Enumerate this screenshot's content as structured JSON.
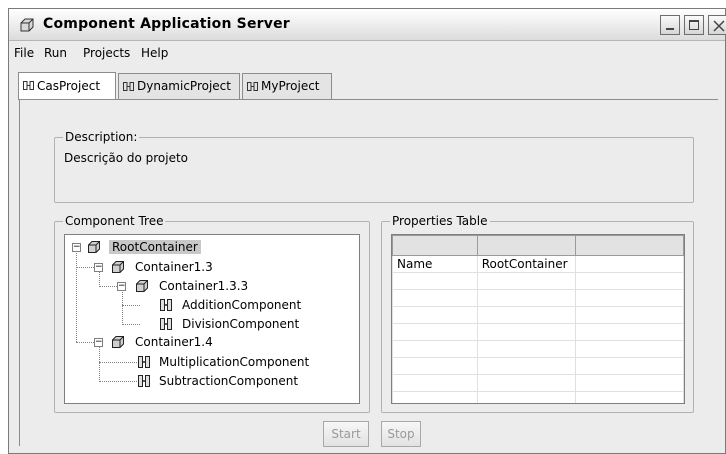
{
  "window": {
    "title": "Component Application Server"
  },
  "menu": [
    "File",
    "Run",
    "Projects",
    "Help"
  ],
  "tabs": [
    {
      "label": "CasProject",
      "active": true
    },
    {
      "label": "DynamicProject",
      "active": false
    },
    {
      "label": "MyProject",
      "active": false
    }
  ],
  "description": {
    "legend": "Description:",
    "text": "Descrição do projeto"
  },
  "tree": {
    "legend": "Component Tree",
    "nodes": [
      {
        "label": "RootContainer",
        "icon": "container-icon",
        "selected": true,
        "expander": "−"
      },
      {
        "label": "Container1.3",
        "icon": "container-icon",
        "expander": "−"
      },
      {
        "label": "Container1.3.3",
        "icon": "container-icon",
        "expander": "−"
      },
      {
        "label": "AdditionComponent",
        "icon": "component-icon"
      },
      {
        "label": "DivisionComponent",
        "icon": "component-icon"
      },
      {
        "label": "Container1.4",
        "icon": "container-icon",
        "expander": "−"
      },
      {
        "label": "MultiplicationComponent",
        "icon": "component-icon"
      },
      {
        "label": "SubtractionComponent",
        "icon": "component-icon"
      }
    ]
  },
  "properties": {
    "legend": "Properties Table",
    "headers": [
      "",
      "",
      ""
    ],
    "rows": [
      [
        "Name",
        "RootContainer",
        ""
      ]
    ]
  },
  "buttons": {
    "start": "Start",
    "stop": "Stop"
  },
  "colors": {
    "window_bg": "#ececec",
    "selection": "#c8c8c8",
    "disabled_text": "#9a9a9a"
  }
}
